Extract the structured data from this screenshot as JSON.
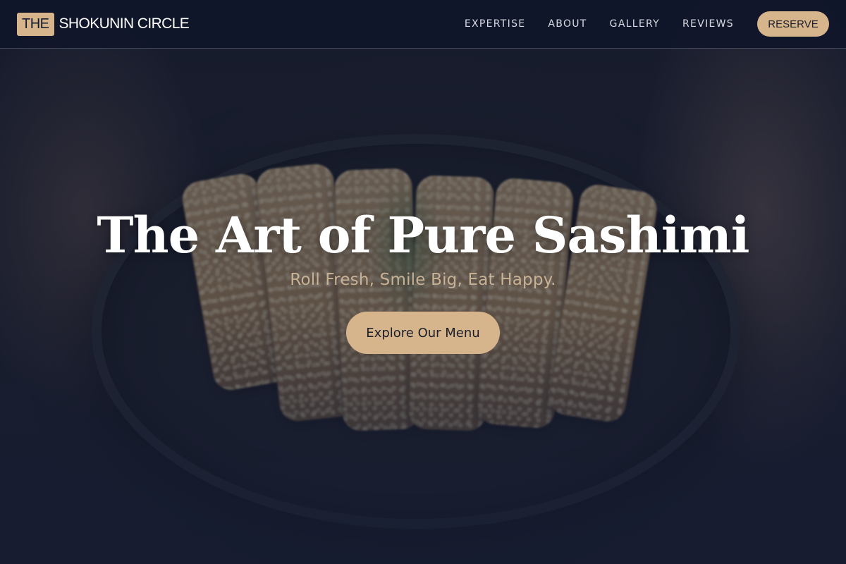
{
  "brand": {
    "prefix": "THE",
    "name": "SHOKUNIN CIRCLE"
  },
  "nav": {
    "links": [
      "EXPERTISE",
      "ABOUT",
      "GALLERY",
      "REVIEWS"
    ],
    "reserve_label": "RESERVE"
  },
  "hero": {
    "title": "The Art of Pure Sashimi",
    "subtitle": "Roll Fresh, Smile Big, Eat Happy.",
    "cta_label": "Explore Our Menu",
    "background_image": "katsu-bowl-photo"
  },
  "colors": {
    "accent": "#d7b58c",
    "navy": "#151c30",
    "subtitle": "#c8b296"
  }
}
